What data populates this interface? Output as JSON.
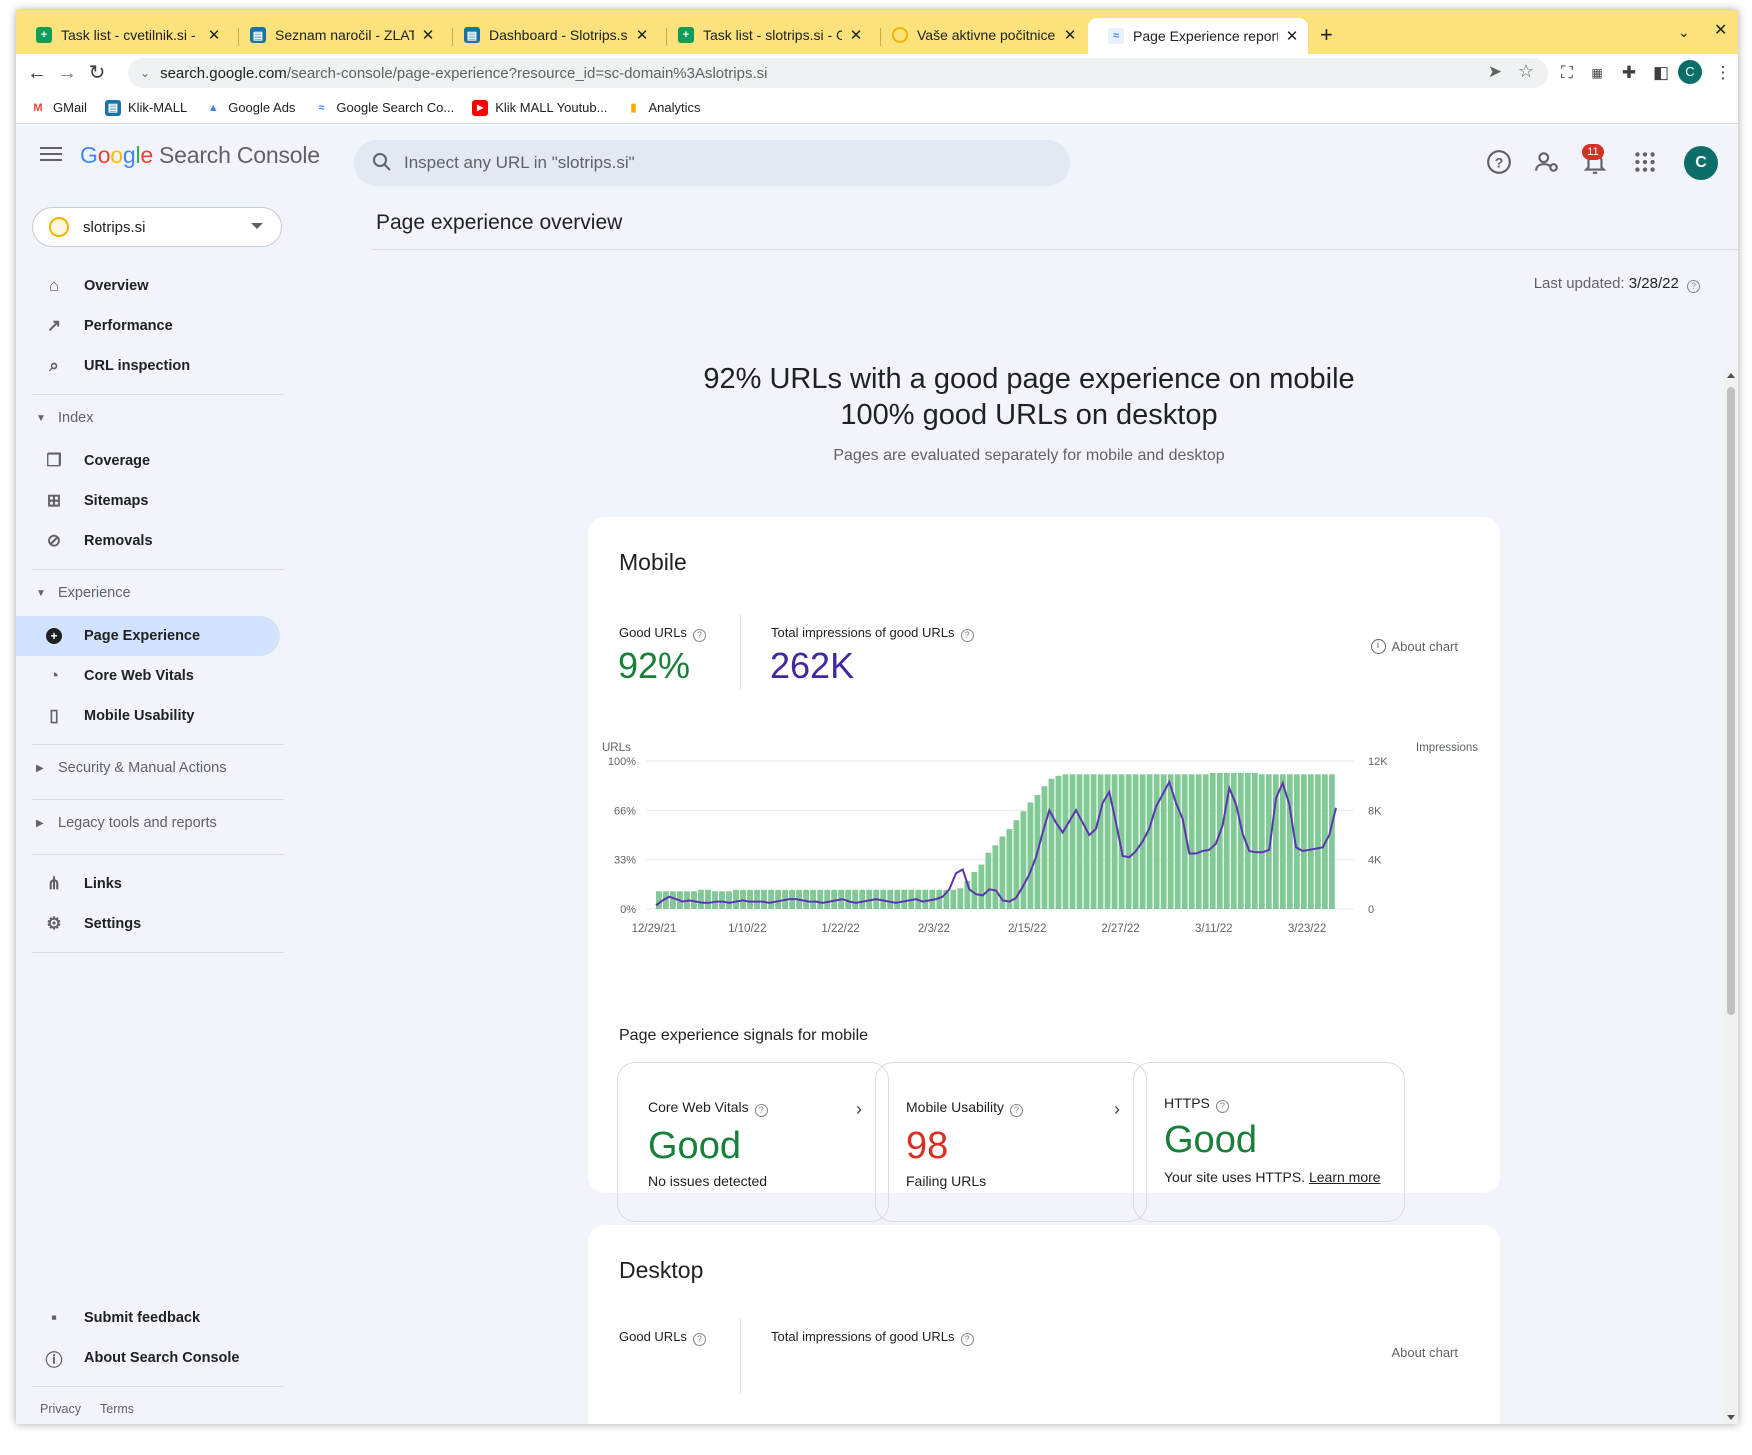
{
  "browser": {
    "tabs": [
      {
        "title": "Task list - cvetilnik.si - Google",
        "fav": "sheets-icon",
        "color": "#0f9d58"
      },
      {
        "title": "Seznam naročil - ZLATARSTVO",
        "fav": "site-icon",
        "color": "#1a73a8"
      },
      {
        "title": "Dashboard - Slotrips.si",
        "fav": "site-icon",
        "color": "#1a73a8"
      },
      {
        "title": "Task list - slotrips.si - Google",
        "fav": "sheets-icon",
        "color": "#0f9d58"
      },
      {
        "title": "Vaše aktivne počitnice v Slov",
        "fav": "sun-icon",
        "color": "#f4b400"
      },
      {
        "title": "Page Experience report",
        "fav": "search-console-icon",
        "color": "#4285f4"
      }
    ],
    "url_host": "search.google.com",
    "url_path": "/search-console/page-experience?resource_id=sc-domain%3Aslotrips.si",
    "bookmarks": [
      {
        "label": "GMail",
        "icon": "gmail-icon"
      },
      {
        "label": "Klik-MALL",
        "icon": "site-icon"
      },
      {
        "label": "Google Ads",
        "icon": "google-ads-icon"
      },
      {
        "label": "Google Search Co...",
        "icon": "search-console-icon"
      },
      {
        "label": "Klik MALL Youtub...",
        "icon": "youtube-icon"
      },
      {
        "label": "Analytics",
        "icon": "analytics-icon"
      }
    ]
  },
  "header": {
    "logo_google": [
      "G",
      "o",
      "o",
      "g",
      "l",
      "e"
    ],
    "logo_product": "Search Console",
    "search_placeholder": "Inspect any URL in \"slotrips.si\"",
    "notifications": "11",
    "avatar_letter": "C"
  },
  "sidebar": {
    "property": "slotrips.si",
    "items": [
      {
        "label": "Overview",
        "icon": "home-icon"
      },
      {
        "label": "Performance",
        "icon": "trending-icon"
      },
      {
        "label": "URL inspection",
        "icon": "search-icon"
      }
    ],
    "index_label": "Index",
    "index_items": [
      {
        "label": "Coverage",
        "icon": "copy-icon"
      },
      {
        "label": "Sitemaps",
        "icon": "sitemap-icon"
      },
      {
        "label": "Removals",
        "icon": "eye-off-icon"
      }
    ],
    "experience_label": "Experience",
    "experience_items": [
      {
        "label": "Page Experience",
        "icon": "plus-circle-icon",
        "active": true
      },
      {
        "label": "Core Web Vitals",
        "icon": "gauge-icon"
      },
      {
        "label": "Mobile Usability",
        "icon": "phone-icon"
      }
    ],
    "security_label": "Security & Manual Actions",
    "legacy_label": "Legacy tools and reports",
    "links_label": "Links",
    "settings_label": "Settings",
    "feedback_label": "Submit feedback",
    "about_label": "About Search Console",
    "privacy": "Privacy",
    "terms": "Terms"
  },
  "main": {
    "title": "Page experience overview",
    "last_updated_label": "Last updated:",
    "last_updated_value": "3/28/22",
    "headline_1": "92% URLs with a good page experience on mobile",
    "headline_2": "100% good URLs on desktop",
    "subline": "Pages are evaluated separately for mobile and desktop",
    "mobile": {
      "title": "Mobile",
      "good_urls_label": "Good URLs",
      "good_urls_value": "92%",
      "impressions_label": "Total impressions of good URLs",
      "impressions_value": "262K",
      "about_chart": "About chart",
      "signals_title": "Page experience signals for mobile",
      "signals": [
        {
          "title": "Core Web Vitals",
          "value": "Good",
          "sub": "No issues detected",
          "color": "#188038"
        },
        {
          "title": "Mobile Usability",
          "value": "98",
          "sub": "Failing URLs",
          "color": "#d93025"
        },
        {
          "title": "HTTPS",
          "value": "Good",
          "sub": "Your site uses HTTPS.",
          "link": "Learn more",
          "color": "#188038"
        }
      ]
    },
    "desktop": {
      "title": "Desktop",
      "good_urls_label": "Good URLs",
      "impressions_label": "Total impressions of good URLs",
      "about_chart": "About chart"
    }
  },
  "chart_data": {
    "type": "bar",
    "left_axis_label": "URLs",
    "right_axis_label": "Impressions",
    "left_ticks": [
      "100%",
      "66%",
      "33%",
      "0%"
    ],
    "right_ticks": [
      "12K",
      "8K",
      "4K",
      "0"
    ],
    "x_ticks": [
      "12/29/21",
      "1/10/22",
      "1/22/22",
      "2/3/22",
      "2/15/22",
      "2/27/22",
      "3/11/22",
      "3/23/22"
    ],
    "ylim_left": [
      0,
      100
    ],
    "ylim_right": [
      0,
      12000
    ],
    "series": [
      {
        "name": "Good URLs",
        "color": "#81c995",
        "values": [
          12,
          12,
          12,
          12,
          12,
          12,
          13,
          13,
          12,
          12,
          12,
          13,
          13,
          13,
          13,
          13,
          13,
          13,
          13,
          13,
          13,
          13,
          13,
          13,
          13,
          13,
          13,
          13,
          13,
          13,
          13,
          13,
          13,
          13,
          13,
          13,
          13,
          13,
          13,
          13,
          13,
          13,
          13,
          14,
          19,
          25,
          30,
          38,
          43,
          49,
          54,
          60,
          66,
          72,
          77,
          83,
          88,
          90,
          91,
          91,
          91,
          91,
          91,
          91,
          91,
          91,
          91,
          91,
          91,
          91,
          91,
          91,
          91,
          91,
          91,
          91,
          91,
          91,
          91,
          92,
          92,
          92,
          92,
          92,
          92,
          92,
          91,
          91,
          91,
          91,
          91,
          91,
          91,
          91,
          91,
          91,
          91
        ]
      },
      {
        "name": "Impressions",
        "color": "#5e35b1",
        "values": [
          300,
          700,
          1000,
          800,
          600,
          700,
          600,
          500,
          500,
          600,
          600,
          500,
          600,
          700,
          600,
          600,
          600,
          500,
          600,
          700,
          800,
          800,
          700,
          600,
          600,
          500,
          600,
          700,
          800,
          600,
          500,
          600,
          700,
          800,
          700,
          600,
          500,
          600,
          700,
          800,
          600,
          700,
          800,
          1000,
          1600,
          2900,
          3200,
          1600,
          1200,
          1100,
          1600,
          1500,
          700,
          600,
          900,
          1800,
          2800,
          4200,
          6200,
          8000,
          7000,
          6200,
          7100,
          8000,
          7000,
          6000,
          6500,
          8600,
          9500,
          7000,
          4300,
          4200,
          4700,
          5500,
          6500,
          8300,
          9300,
          10300,
          8600,
          7300,
          4500,
          4500,
          4700,
          4800,
          5300,
          6800,
          9800,
          8500,
          6100,
          4700,
          4600,
          4600,
          4800,
          9000,
          10200,
          8500,
          5000,
          4700,
          4800,
          4900,
          5000,
          6000,
          8200
        ]
      }
    ]
  }
}
